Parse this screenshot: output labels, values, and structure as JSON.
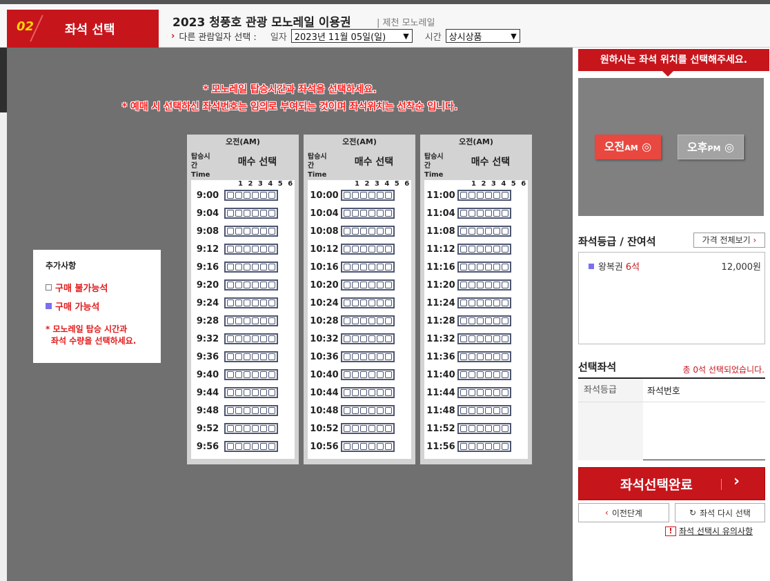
{
  "header": {
    "step_number": "02",
    "step_title": "좌석 선택",
    "product_title": "2023 청풍호 관광 모노레일 이용권",
    "product_sub": "| 제천 모노레일",
    "date_prompt": "다른 관람일자 선택 :",
    "date_label": "일자",
    "date_value": "2023년 11월 05일(일)",
    "time_label": "시간",
    "time_value": "상시상품"
  },
  "notices": {
    "line1": "* 모노레일 탑승시간과 좌석을 선택하세요.",
    "line2": "* 예매 시 선택하신 좌석번호는 임의로 부여되는 것이며 좌석위치는 선착순 입니다."
  },
  "legend": {
    "title": "추가사항",
    "unavailable": "구매 불가능석",
    "available": "구매 가능석",
    "note_line1": "* 모노레일 탑승 시간과",
    "note_line2": "좌석 수량을 선택하세요."
  },
  "schedule": {
    "column_header": "오전(AM)",
    "time_label": "탑승시간",
    "time_label_en": "Time",
    "qty_label": "매수 선택",
    "seat_numbers": "1 2 3 4 5 6",
    "columns": [
      [
        "9:00",
        "9:04",
        "9:08",
        "9:12",
        "9:16",
        "9:20",
        "9:24",
        "9:28",
        "9:32",
        "9:36",
        "9:40",
        "9:44",
        "9:48",
        "9:52",
        "9:56"
      ],
      [
        "10:00",
        "10:04",
        "10:08",
        "10:12",
        "10:16",
        "10:20",
        "10:24",
        "10:28",
        "10:32",
        "10:36",
        "10:40",
        "10:44",
        "10:48",
        "10:52",
        "10:56"
      ],
      [
        "11:00",
        "11:04",
        "11:08",
        "11:12",
        "11:16",
        "11:20",
        "11:24",
        "11:28",
        "11:32",
        "11:36",
        "11:40",
        "11:44",
        "11:48",
        "11:52",
        "11:56"
      ]
    ]
  },
  "sidebar": {
    "pick_title": "원하시는 좌석 위치를 선택해주세요.",
    "am_label": "오전",
    "am_sub": "AM",
    "pm_label": "오후",
    "pm_sub": "PM",
    "grade_title": "좌석등급 / 잔여석",
    "price_all": "가격 전체보기",
    "grade_name": "왕복권",
    "grade_count": "6석",
    "grade_price": "12,000원",
    "selected_title": "선택좌석",
    "selected_count": "총 0석 선택되었습니다.",
    "col_grade": "좌석등급",
    "col_number": "좌석번호",
    "done_label": "좌석선택완료",
    "prev_label": "이전단계",
    "reset_label": "좌석 다시 선택",
    "caution_label": "좌석 선택시 유의사항"
  },
  "colors": {
    "brand_red": "#c7151c",
    "available_seat": "#7a6ff0",
    "panel_gray": "#707070"
  }
}
